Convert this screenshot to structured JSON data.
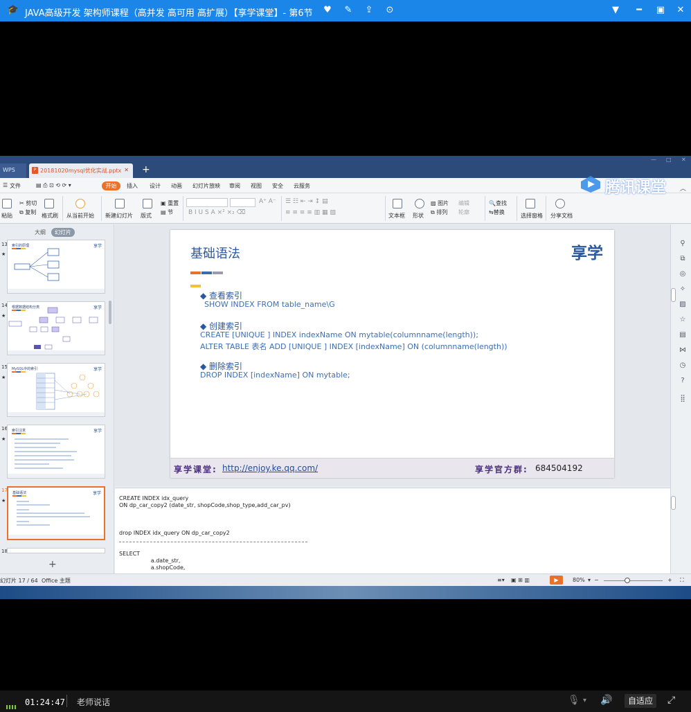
{
  "player": {
    "title": "JAVA高级开发 架构师课程（高并发 高可用 高扩展）【享学课堂】- 第6节",
    "icons": [
      "graduation-cap-icon",
      "heart-icon",
      "edit-icon",
      "share-icon",
      "settings-icon",
      "chevron-down-icon",
      "minimize-icon",
      "maximize-icon",
      "close-icon"
    ],
    "accent_color": "#1c86e8"
  },
  "watermark": {
    "text": "腾讯课堂"
  },
  "wps": {
    "app_tab": "WPS",
    "doc_tab": "20181020mysql优化实战.pptx",
    "menu": [
      "文件",
      "开始",
      "插入",
      "设计",
      "动画",
      "幻灯片放映",
      "审阅",
      "视图",
      "安全",
      "云服务"
    ],
    "active_menu": "开始",
    "ribbon": {
      "paste": "粘贴",
      "cut": "剪切",
      "copy": "复制",
      "format_painter": "格式刷",
      "from_start": "从当前开始",
      "new_slide": "新建幻灯片",
      "layout": "版式",
      "reset": "重置",
      "section": "节",
      "picture": "图片",
      "arrange": "排列",
      "textbox": "文本框",
      "shape": "形状",
      "find": "查找",
      "replace": "替换",
      "select_pane": "选择窗格",
      "share_doc": "分享文档",
      "fill": "填充",
      "outline": "轮廓",
      "edit": "编辑"
    },
    "left_panel": {
      "tab_outline": "大纲",
      "tab_slides": "幻灯片",
      "thumbs": [
        {
          "num": "13",
          "title": "索引的原理"
        },
        {
          "num": "14",
          "title": "根据数据结构分类"
        },
        {
          "num": "15",
          "title": "MySQL中的索引"
        },
        {
          "num": "16",
          "title": "索引注意"
        },
        {
          "num": "17",
          "title": "基础语法"
        },
        {
          "num": "18",
          "title": ""
        }
      ]
    },
    "slide": {
      "title": "基础语法",
      "logo": "享学",
      "sections": [
        {
          "heading": "◆ 查看索引",
          "lines": [
            "SHOW INDEX FROM table_name\\G"
          ]
        },
        {
          "heading": "◆ 创建索引",
          "lines": [
            "CREATE  [UNIQUE ] INDEX indexName ON mytable(columnname(length));",
            "ALTER TABLE 表名 ADD  [UNIQUE ]  INDEX [indexName] ON (columnname(length))"
          ]
        },
        {
          "heading": "◆ 删除索引",
          "lines": [
            "DROP INDEX [indexName] ON mytable;"
          ]
        }
      ],
      "footer": {
        "brand": "享学课堂:",
        "url": "http://enjoy.ke.qq.com/",
        "qq_label": "享学官方群:",
        "qq": "684504192"
      }
    },
    "notes": [
      "CREATE INDEX idx_query",
      "ON dp_car_copy2 (date_str, shopCode,shop_type,add_car_pv)",
      "drop INDEX idx_query ON dp_car_copy2",
      "SELECT",
      "                  a.date_str,",
      "                  a.shopCode,"
    ],
    "status": {
      "slide_count": "幻灯片 17 / 64",
      "theme": "Office 主题",
      "zoom": "80%"
    }
  },
  "controls": {
    "time": "01:24:47",
    "teacher": "老师说话",
    "adapt": "自适应"
  }
}
